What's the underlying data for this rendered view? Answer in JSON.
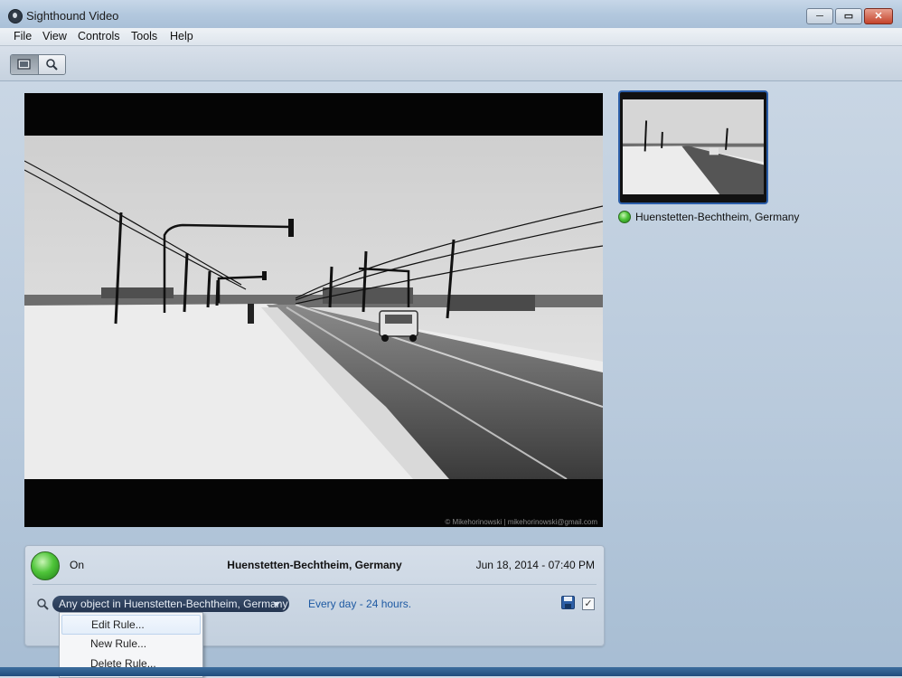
{
  "window": {
    "title": "Sighthound Video",
    "controls": {
      "minimize": "─",
      "maximize": "▭",
      "close": "✕"
    }
  },
  "menu": [
    "File",
    "View",
    "Controls",
    "Tools",
    "Help"
  ],
  "toolbar": {
    "view_modes": [
      {
        "icon": "monitor-icon",
        "active": true
      },
      {
        "icon": "search-icon",
        "active": false
      }
    ]
  },
  "video": {
    "watermark": "© Mikehorinowski | mikehorinowski@gmail.com"
  },
  "camera_list": [
    {
      "name": "Huenstetten-Bechtheim, Germany",
      "status_color": "#3dbb2f",
      "selected": true
    }
  ],
  "info_panel": {
    "status": "On",
    "camera_name": "Huenstetten-Bechtheim, Germany",
    "datetime": "Jun 18, 2014 - 07:40 PM",
    "rule_selected": "Any object in Huenstetten-Bechtheim, Germany",
    "schedule": "Every day - 24 hours.",
    "rule_enabled_mark": "✓"
  },
  "rule_menu": {
    "items": [
      "Edit Rule...",
      "New Rule...",
      "Delete Rule..."
    ],
    "highlighted": "Edit Rule..."
  },
  "colors": {
    "accent": "#2b5ea9",
    "schedule_link": "#1f5aa3",
    "status_on": "#3dbb2f"
  }
}
